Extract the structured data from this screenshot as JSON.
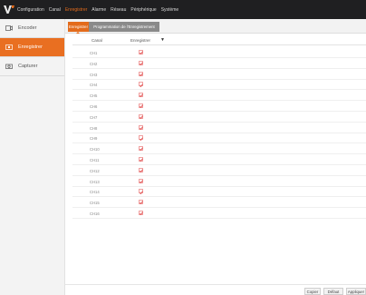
{
  "topbar": {
    "items": [
      "Configuration",
      "Canal",
      "Enregistrer",
      "Alarme",
      "Réseau",
      "Périphérique",
      "Système"
    ],
    "active_index": 2
  },
  "sidebar": {
    "items": [
      {
        "label": "Encoder",
        "icon": "camera-icon"
      },
      {
        "label": "Enregistrer",
        "icon": "record-icon"
      },
      {
        "label": "Capturer",
        "icon": "capture-icon"
      }
    ],
    "active_index": 1
  },
  "tabs": {
    "items": [
      "Enregistrer",
      "Programmation de l'Enregistrement"
    ],
    "active_index": 0
  },
  "table": {
    "headers": {
      "canal": "Canal",
      "enregistrer": "Enregistrer"
    },
    "rows": [
      "CH1",
      "CH2",
      "CH3",
      "CH4",
      "CH5",
      "CH6",
      "CH7",
      "CH8",
      "CH9",
      "CH10",
      "CH11",
      "CH12",
      "CH13",
      "CH14",
      "CH15",
      "CH16"
    ]
  },
  "buttons": {
    "copy": "Copier",
    "default": "Défaut",
    "apply": "Appliquer"
  },
  "colors": {
    "accent": "#e36b1b",
    "topbar": "#1f1f21",
    "sidebar_active": "#e96f21"
  }
}
